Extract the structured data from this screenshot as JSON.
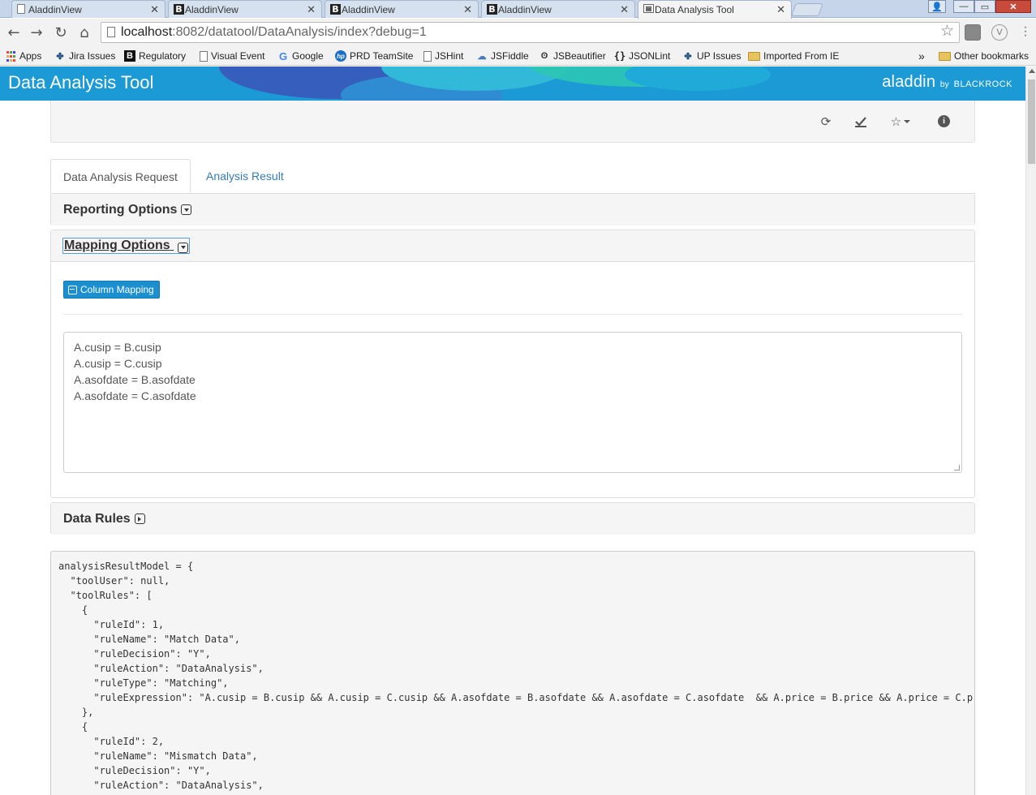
{
  "browser": {
    "tabs": [
      {
        "title": "AladdinView",
        "icon": "doc"
      },
      {
        "title": "AladdinView",
        "icon": "b"
      },
      {
        "title": "AladdinView",
        "icon": "b"
      },
      {
        "title": "AladdinView",
        "icon": "b"
      },
      {
        "title": "Data Analysis Tool",
        "icon": "chart",
        "active": true
      }
    ],
    "url_host": "localhost",
    "url_rest": ":8082/datatool/DataAnalysis/index?debug=1",
    "ext_badge": "V",
    "bookmarks": {
      "apps": "Apps",
      "jira": "Jira Issues",
      "regulatory": "Regulatory",
      "visual_event": "Visual Event",
      "google": "Google",
      "prd": "PRD TeamSite",
      "jshint": "JSHint",
      "jsfiddle": "JSFiddle",
      "jsbeautifier": "JSBeautifier",
      "jsonlint": "JSONLint",
      "up_issues": "UP Issues",
      "imported": "Imported From IE",
      "overflow": "»",
      "other": "Other bookmarks"
    }
  },
  "app": {
    "title": "Data Analysis Tool",
    "brand_main": "aladdin",
    "brand_by": "by",
    "brand_company": "BLACKROCK"
  },
  "toolbar_icons": [
    "refresh-icon",
    "check-download-icon",
    "star-icon",
    "info-icon"
  ],
  "tabs": {
    "request": "Data Analysis Request",
    "result": "Analysis Result"
  },
  "panels": {
    "reporting": "Reporting Options",
    "mapping": "Mapping Options",
    "rules": "Data Rules"
  },
  "mapping": {
    "button_label": "Column Mapping",
    "textarea": "A.cusip = B.cusip\nA.cusip = C.cusip\nA.asofdate = B.asofdate\nA.asofdate = C.asofdate"
  },
  "debug_output": "analysisResultModel = {\n  \"toolUser\": null,\n  \"toolRules\": [\n    {\n      \"ruleId\": 1,\n      \"ruleName\": \"Match Data\",\n      \"ruleDecision\": \"Y\",\n      \"ruleAction\": \"DataAnalysis\",\n      \"ruleType\": \"Matching\",\n      \"ruleExpression\": \"A.cusip = B.cusip && A.cusip = C.cusip && A.asofdate = B.asofdate && A.asofdate = C.asofdate  && A.price = B.price && A.price = C.pri\n    },\n    {\n      \"ruleId\": 2,\n      \"ruleName\": \"Mismatch Data\",\n      \"ruleDecision\": \"Y\",\n      \"ruleAction\": \"DataAnalysis\","
}
